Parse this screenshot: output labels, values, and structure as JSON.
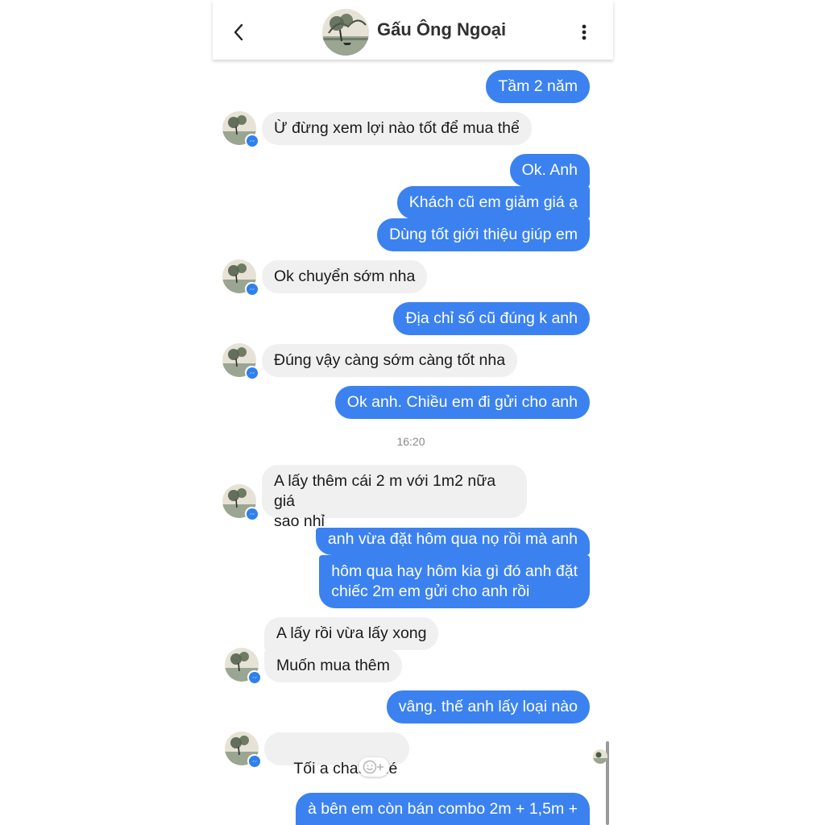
{
  "header": {
    "contact_name": "Gấu Ông Ngoại",
    "back_icon": "chevron-left-icon",
    "menu_icon": "more-vertical-icon"
  },
  "colors": {
    "outgoing_bubble": "#3b82f0",
    "incoming_bubble": "#f0f0f0",
    "messenger_badge": "#2f80ed"
  },
  "messages": [
    {
      "dir": "out",
      "text": "Tầm 2 năm"
    },
    {
      "dir": "in",
      "text": "Ừ đừng xem lợi nào tốt để mua thể"
    },
    {
      "dir": "out",
      "text": "Ok. Anh"
    },
    {
      "dir": "out",
      "text": "Khách cũ em giảm giá ạ"
    },
    {
      "dir": "out",
      "text": "Dùng tốt giới thiệu giúp em"
    },
    {
      "dir": "in",
      "text": "Ok chuyển sớm nha"
    },
    {
      "dir": "out",
      "text": "Địa chỉ số cũ đúng k anh"
    },
    {
      "dir": "in",
      "text": "Đúng vậy càng sớm càng tốt nha"
    },
    {
      "dir": "out",
      "text": "Ok anh. Chiều em đi gửi cho anh"
    },
    {
      "dir": "in",
      "lines": [
        "A lấy thêm cái 2 m với 1m2 nữa giá",
        "sao nhỉ"
      ]
    },
    {
      "dir": "out",
      "text": "anh vừa đặt hôm qua nọ rồi mà anh"
    },
    {
      "dir": "out",
      "lines": [
        "hôm qua hay hôm kia gì đó anh đặt",
        "chiếc 2m em gửi cho anh rồi"
      ]
    },
    {
      "dir": "in",
      "text": "A lấy rồi vừa lấy xong"
    },
    {
      "dir": "in",
      "text": "Muốn mua thêm"
    },
    {
      "dir": "out",
      "text": "vâng. thế anh lấy loại nào"
    },
    {
      "dir": "in",
      "text": "Tối a chat  nhé"
    },
    {
      "dir": "out",
      "text": "à bên em còn bán combo 2m + 1,5m +"
    }
  ],
  "timestamp": "16:20",
  "reaction_icon": "add-reaction-icon"
}
